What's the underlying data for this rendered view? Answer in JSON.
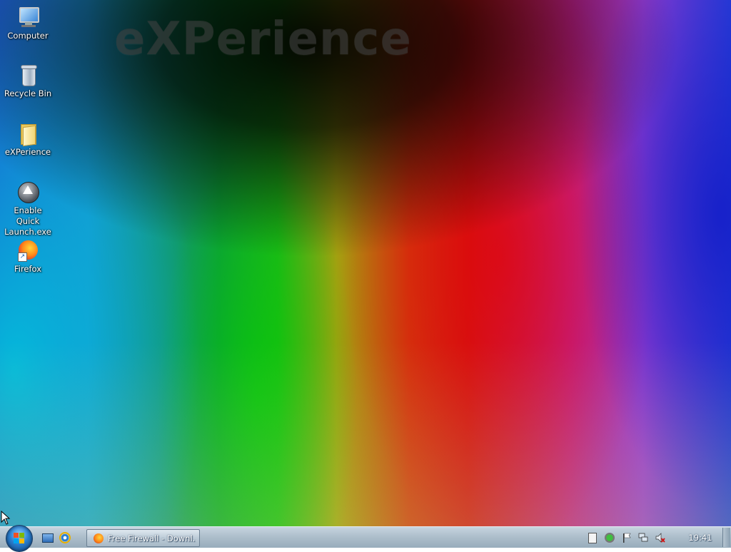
{
  "wallpaper": {
    "logo_text": "eXPerience"
  },
  "desktop_icons": [
    {
      "label": "Computer",
      "icon": "computer-icon"
    },
    {
      "label": "Recycle Bin",
      "icon": "recycle-bin-icon"
    },
    {
      "label": "eXPerience",
      "icon": "folder-icon"
    },
    {
      "label_line1": "Enable Quick",
      "label_line2": "Launch.exe",
      "icon": "quick-launch-exe-icon"
    },
    {
      "label": "Firefox",
      "icon": "firefox-icon"
    }
  ],
  "taskbar": {
    "start_button": {
      "icon": "windows-logo-icon"
    },
    "quick_launch": [
      {
        "icon": "show-desktop-icon"
      },
      {
        "icon": "internet-explorer-icon"
      }
    ],
    "tasks": [
      {
        "label": "Free Firewall - Downl...",
        "icon": "firefox-icon",
        "active": true
      }
    ],
    "tray_icons": [
      "document-icon",
      "security-center-icon",
      "action-center-flag-icon",
      "network-icon",
      "volume-muted-icon"
    ],
    "clock": "19:41"
  },
  "colors": {
    "taskbar_top": "#c7d4df",
    "taskbar_bottom": "#98acbb",
    "icon_label": "#ffffff"
  }
}
